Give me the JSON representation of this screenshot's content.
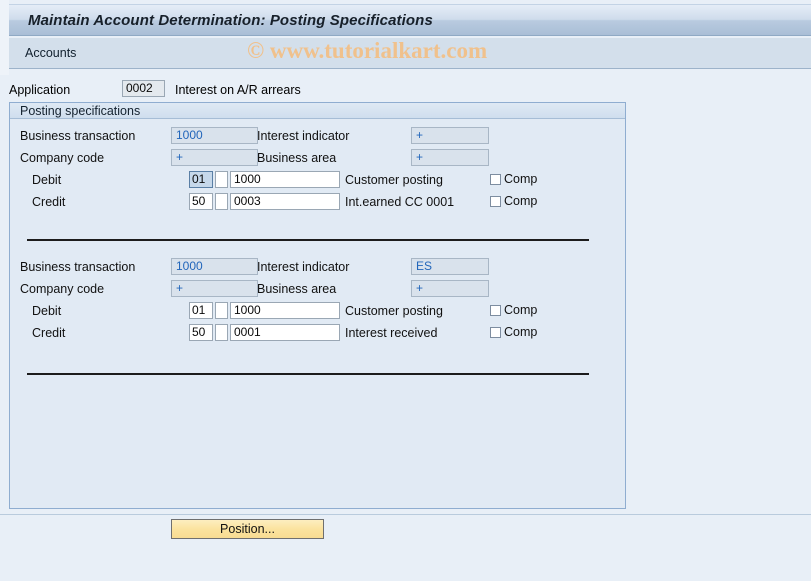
{
  "window": {
    "title": "Maintain Account Determination: Posting Specifications"
  },
  "toolbar": {
    "accounts_label": "Accounts"
  },
  "watermark": {
    "text": "© www.tutorialkart.com",
    "color": "#f0c18c"
  },
  "application": {
    "label": "Application",
    "value": "0002",
    "description": "Interest on A/R arrears"
  },
  "groupbox": {
    "title": "Posting specifications"
  },
  "labels": {
    "business_transaction": "Business transaction",
    "interest_indicator": "Interest indicator",
    "company_code": "Company code",
    "business_area": "Business area",
    "debit": "Debit",
    "credit": "Credit",
    "comp": "Comp"
  },
  "blocks": [
    {
      "business_transaction": "1000",
      "interest_indicator": "+",
      "company_code": "+",
      "business_area": "+",
      "rows": [
        {
          "type": "Debit",
          "posting_key": "01",
          "special_gl": "",
          "account": "1000",
          "description": "Customer posting",
          "comp_checked": false,
          "posting_key_selected": true
        },
        {
          "type": "Credit",
          "posting_key": "50",
          "special_gl": "",
          "account": "0003",
          "description": "Int.earned CC 0001",
          "comp_checked": false,
          "posting_key_selected": false
        }
      ]
    },
    {
      "business_transaction": "1000",
      "interest_indicator": "ES",
      "company_code": "+",
      "business_area": "+",
      "rows": [
        {
          "type": "Debit",
          "posting_key": "01",
          "special_gl": "",
          "account": "1000",
          "description": "Customer posting",
          "comp_checked": false,
          "posting_key_selected": false
        },
        {
          "type": "Credit",
          "posting_key": "50",
          "special_gl": "",
          "account": "0001",
          "description": "Interest received",
          "comp_checked": false,
          "posting_key_selected": false
        }
      ]
    }
  ],
  "footer": {
    "position_button": "Position..."
  }
}
